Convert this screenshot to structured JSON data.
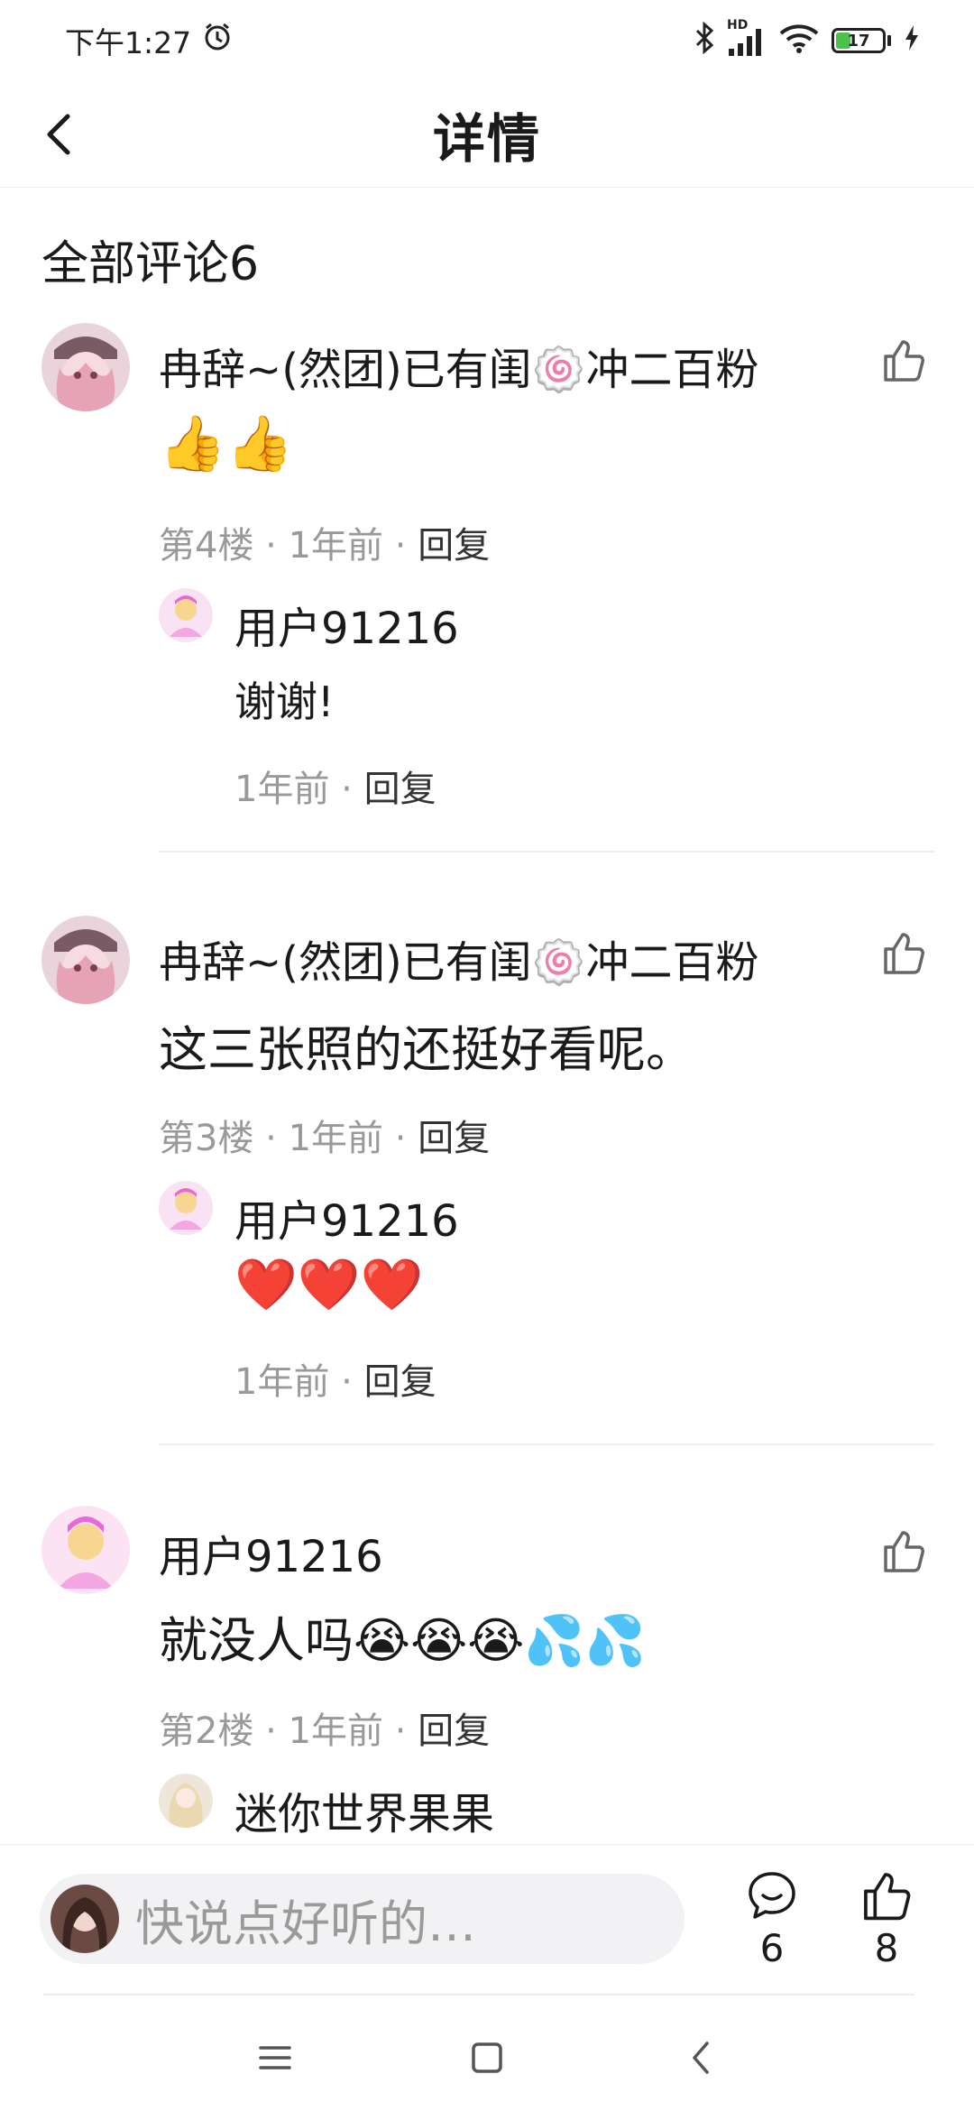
{
  "status_bar": {
    "time": "下午1:27",
    "network_label": "HD",
    "battery": "17"
  },
  "header": {
    "title": "详情"
  },
  "comments_heading": "全部评论6",
  "comments": [
    {
      "author": "冉辞~(然团)已有闺🍥冲二百粉",
      "content": "👍👍",
      "floor": "第4楼",
      "time": "1年前",
      "reply_label": "回复",
      "reply": {
        "author": "用户91216",
        "content": "谢谢!",
        "time": "1年前",
        "reply_label": "回复"
      }
    },
    {
      "author": "冉辞~(然团)已有闺🍥冲二百粉",
      "content": "这三张照的还挺好看呢。",
      "floor": "第3楼",
      "time": "1年前",
      "reply_label": "回复",
      "reply": {
        "author": "用户91216",
        "content": "❤️❤️❤️",
        "time": "1年前",
        "reply_label": "回复"
      }
    },
    {
      "author": "用户91216",
      "content": "就没人吗😭😭😭💦💦",
      "floor": "第2楼",
      "time": "1年前",
      "reply_label": "回复",
      "reply": {
        "author": "迷你世界果果"
      }
    }
  ],
  "bottom_bar": {
    "input_placeholder": "快说点好听的…",
    "comment_count": "6",
    "like_count": "8"
  },
  "colors": {
    "text_primary": "#1a1a1a",
    "text_secondary": "#999999",
    "input_bg": "#f2f2f4",
    "battery_green": "#4cc24a"
  }
}
